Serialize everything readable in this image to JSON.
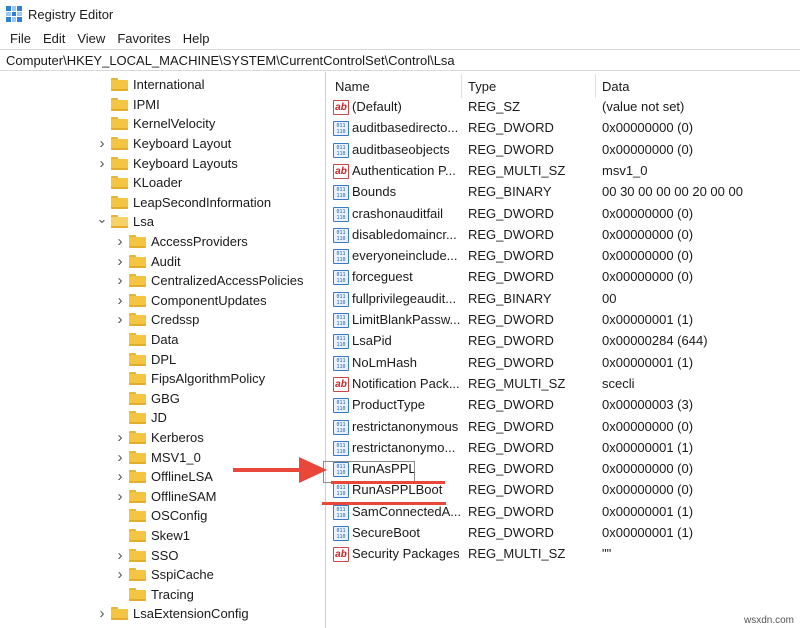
{
  "window": {
    "title": "Registry Editor",
    "icon": "registry-editor-icon"
  },
  "menu": [
    "File",
    "Edit",
    "View",
    "Favorites",
    "Help"
  ],
  "address": "Computer\\HKEY_LOCAL_MACHINE\\SYSTEM\\CurrentControlSet\\Control\\Lsa",
  "tree": [
    {
      "label": "International",
      "depth": 0,
      "expander": "none"
    },
    {
      "label": "IPMI",
      "depth": 0,
      "expander": "none"
    },
    {
      "label": "KernelVelocity",
      "depth": 0,
      "expander": "none"
    },
    {
      "label": "Keyboard Layout",
      "depth": 0,
      "expander": "collapsed"
    },
    {
      "label": "Keyboard Layouts",
      "depth": 0,
      "expander": "collapsed"
    },
    {
      "label": "KLoader",
      "depth": 0,
      "expander": "none"
    },
    {
      "label": "LeapSecondInformation",
      "depth": 0,
      "expander": "none"
    },
    {
      "label": "Lsa",
      "depth": 0,
      "expander": "expanded",
      "selected": true
    },
    {
      "label": "AccessProviders",
      "depth": 1,
      "expander": "collapsed"
    },
    {
      "label": "Audit",
      "depth": 1,
      "expander": "collapsed"
    },
    {
      "label": "CentralizedAccessPolicies",
      "depth": 1,
      "expander": "collapsed"
    },
    {
      "label": "ComponentUpdates",
      "depth": 1,
      "expander": "collapsed"
    },
    {
      "label": "Credssp",
      "depth": 1,
      "expander": "collapsed"
    },
    {
      "label": "Data",
      "depth": 1,
      "expander": "none"
    },
    {
      "label": "DPL",
      "depth": 1,
      "expander": "none"
    },
    {
      "label": "FipsAlgorithmPolicy",
      "depth": 1,
      "expander": "none"
    },
    {
      "label": "GBG",
      "depth": 1,
      "expander": "none"
    },
    {
      "label": "JD",
      "depth": 1,
      "expander": "none"
    },
    {
      "label": "Kerberos",
      "depth": 1,
      "expander": "collapsed"
    },
    {
      "label": "MSV1_0",
      "depth": 1,
      "expander": "collapsed"
    },
    {
      "label": "OfflineLSA",
      "depth": 1,
      "expander": "collapsed"
    },
    {
      "label": "OfflineSAM",
      "depth": 1,
      "expander": "collapsed"
    },
    {
      "label": "OSConfig",
      "depth": 1,
      "expander": "none"
    },
    {
      "label": "Skew1",
      "depth": 1,
      "expander": "none"
    },
    {
      "label": "SSO",
      "depth": 1,
      "expander": "collapsed"
    },
    {
      "label": "SspiCache",
      "depth": 1,
      "expander": "collapsed"
    },
    {
      "label": "Tracing",
      "depth": 1,
      "expander": "none"
    },
    {
      "label": "LsaExtensionConfig",
      "depth": 0,
      "expander": "collapsed"
    }
  ],
  "columns": {
    "name": "Name",
    "type": "Type",
    "data": "Data"
  },
  "values": [
    {
      "name": "(Default)",
      "type": "REG_SZ",
      "data": "(value not set)",
      "icon": "string-value-icon"
    },
    {
      "name": "auditbasedirecto...",
      "type": "REG_DWORD",
      "data": "0x00000000 (0)",
      "icon": "binary-value-icon"
    },
    {
      "name": "auditbaseobjects",
      "type": "REG_DWORD",
      "data": "0x00000000 (0)",
      "icon": "binary-value-icon"
    },
    {
      "name": "Authentication P...",
      "type": "REG_MULTI_SZ",
      "data": "msv1_0",
      "icon": "string-value-icon"
    },
    {
      "name": "Bounds",
      "type": "REG_BINARY",
      "data": "00 30 00 00 00 20 00 00",
      "icon": "binary-value-icon"
    },
    {
      "name": "crashonauditfail",
      "type": "REG_DWORD",
      "data": "0x00000000 (0)",
      "icon": "binary-value-icon"
    },
    {
      "name": "disabledomaincr...",
      "type": "REG_DWORD",
      "data": "0x00000000 (0)",
      "icon": "binary-value-icon"
    },
    {
      "name": "everyoneinclude...",
      "type": "REG_DWORD",
      "data": "0x00000000 (0)",
      "icon": "binary-value-icon"
    },
    {
      "name": "forceguest",
      "type": "REG_DWORD",
      "data": "0x00000000 (0)",
      "icon": "binary-value-icon"
    },
    {
      "name": "fullprivilegeaudit...",
      "type": "REG_BINARY",
      "data": "00",
      "icon": "binary-value-icon"
    },
    {
      "name": "LimitBlankPassw...",
      "type": "REG_DWORD",
      "data": "0x00000001 (1)",
      "icon": "binary-value-icon"
    },
    {
      "name": "LsaPid",
      "type": "REG_DWORD",
      "data": "0x00000284 (644)",
      "icon": "binary-value-icon"
    },
    {
      "name": "NoLmHash",
      "type": "REG_DWORD",
      "data": "0x00000001 (1)",
      "icon": "binary-value-icon"
    },
    {
      "name": "Notification Pack...",
      "type": "REG_MULTI_SZ",
      "data": "scecli",
      "icon": "string-value-icon"
    },
    {
      "name": "ProductType",
      "type": "REG_DWORD",
      "data": "0x00000003 (3)",
      "icon": "binary-value-icon"
    },
    {
      "name": "restrictanonymous",
      "type": "REG_DWORD",
      "data": "0x00000000 (0)",
      "icon": "binary-value-icon"
    },
    {
      "name": "restrictanonymo...",
      "type": "REG_DWORD",
      "data": "0x00000001 (1)",
      "icon": "binary-value-icon"
    },
    {
      "name": "RunAsPPL",
      "type": "REG_DWORD",
      "data": "0x00000000 (0)",
      "icon": "binary-value-icon",
      "focused": true
    },
    {
      "name": "RunAsPPLBoot",
      "type": "REG_DWORD",
      "data": "0x00000000 (0)",
      "icon": "binary-value-icon"
    },
    {
      "name": "SamConnectedA...",
      "type": "REG_DWORD",
      "data": "0x00000001 (1)",
      "icon": "binary-value-icon"
    },
    {
      "name": "SecureBoot",
      "type": "REG_DWORD",
      "data": "0x00000001 (1)",
      "icon": "binary-value-icon"
    },
    {
      "name": "Security Packages",
      "type": "REG_MULTI_SZ",
      "data": "\"\"",
      "icon": "string-value-icon"
    }
  ],
  "annotation": {
    "arrow_color": "#e8473a",
    "underline_color": "#e8473a"
  },
  "watermark": "wsxdn.com"
}
